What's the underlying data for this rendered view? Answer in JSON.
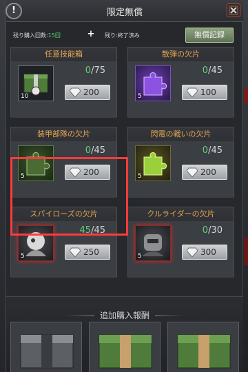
{
  "header": {
    "info_label": "!",
    "title": "限定無償"
  },
  "info_row": {
    "count_label": "残り購入回数:",
    "count_value": "15回",
    "end_label": "残り:終了済み",
    "free_record_label": "無償記録"
  },
  "cards": [
    {
      "title": "任意技能箱",
      "qty": "10",
      "progress_current": "0",
      "progress_max": "/75",
      "price": "200",
      "icon": "green-skill-chest-icon"
    },
    {
      "title": "散弾の欠片",
      "qty": "5",
      "progress_current": "0",
      "progress_max": "/45",
      "price": "100",
      "icon": "purple-puzzle-piece-icon"
    },
    {
      "title": "装甲部隊の欠片",
      "qty": "5",
      "progress_current": "0",
      "progress_max": "/45",
      "price": "200",
      "icon": "green-puzzle-piece-icon"
    },
    {
      "title": "閃電の戦いの欠片",
      "qty": "5",
      "progress_current": "0",
      "progress_max": "/45",
      "price": "200",
      "icon": "yellow-green-puzzle-piece-icon"
    },
    {
      "title": "スパイローズの欠片",
      "qty": "5",
      "progress_current": "45",
      "progress_max": "/45",
      "price": "250",
      "icon": "spy-rose-portrait-icon"
    },
    {
      "title": "クルライダーの欠片",
      "qty": "5",
      "progress_current": "0",
      "progress_max": "/30",
      "price": "300",
      "icon": "crew-rider-portrait-icon"
    }
  ],
  "footer": {
    "title": "追加購入報酬",
    "rewards": [
      "gray-chest-icon",
      "green-chest-icon",
      "green-chest-icon"
    ]
  },
  "colors": {
    "accent_orange": "#e7a64f",
    "progress_green": "#5fd27a",
    "highlight_red": "#ff3b3b"
  }
}
